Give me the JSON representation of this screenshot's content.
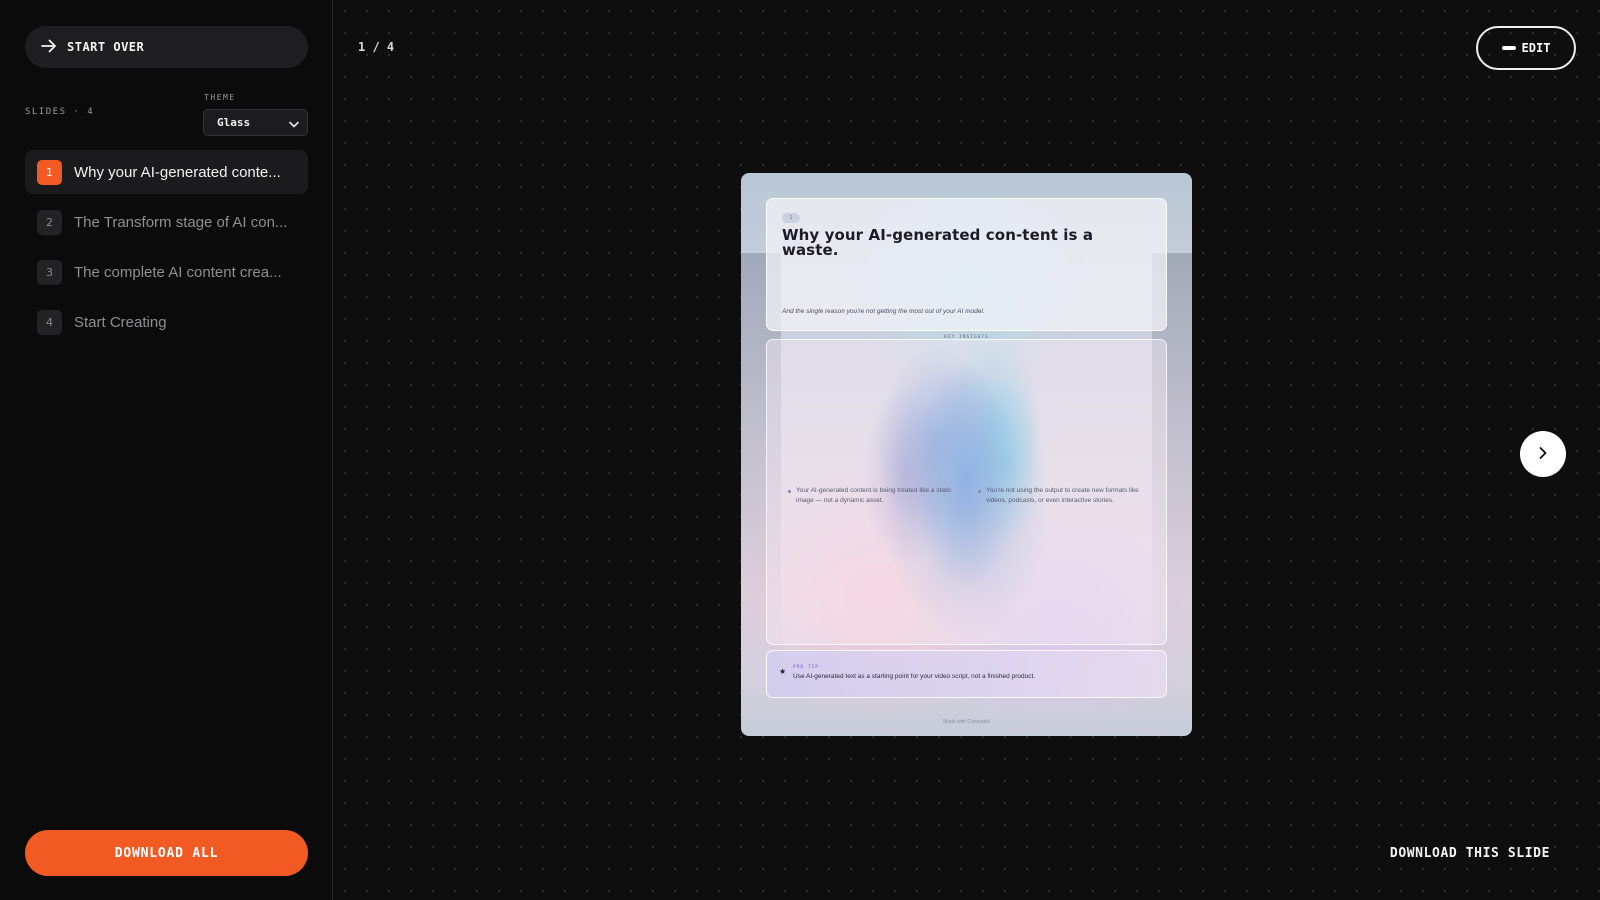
{
  "sidebar": {
    "start_over_label": "START OVER",
    "slides_count_label": "SLIDES · 4",
    "theme_label": "THEME",
    "theme_value": "Glass",
    "items": [
      {
        "num": "1",
        "title": "Why your AI-generated conte...",
        "active": true
      },
      {
        "num": "2",
        "title": "The Transform stage of AI con...",
        "active": false
      },
      {
        "num": "3",
        "title": "The complete AI content crea...",
        "active": false
      },
      {
        "num": "4",
        "title": "Start Creating",
        "active": false
      }
    ],
    "download_all_label": "DOWNLOAD ALL"
  },
  "main": {
    "counter": "1 / 4",
    "edit_label": "EDIT",
    "download_slide_label": "DOWNLOAD THIS SLIDE"
  },
  "slide": {
    "badge": "1",
    "heading": "Why your AI-generated con-tent is a waste.",
    "subtitle": "And the single reason you're not getting the most out of your AI model.",
    "insights_label": "KEY INSIGHTS",
    "points": [
      "Your AI-generated content is being treated like a static image — not a dynamic asset.",
      "You're not using the output to create new formats like videos, podcasts, or even interactive stories."
    ],
    "tip_label": "PRO TIP",
    "tip_text": "Use AI-generated text as a starting point for your video script, not a finished product.",
    "footer": "Made with Carousels"
  },
  "colors": {
    "accent": "#f25a24",
    "background": "#0d0d0e",
    "panel": "#1e1e20"
  },
  "icons": {
    "start_over": "arrow-right-icon",
    "theme_select": "chevron-down-icon",
    "next": "chevron-right-icon",
    "edit": "dash-icon",
    "tip": "star-icon"
  }
}
